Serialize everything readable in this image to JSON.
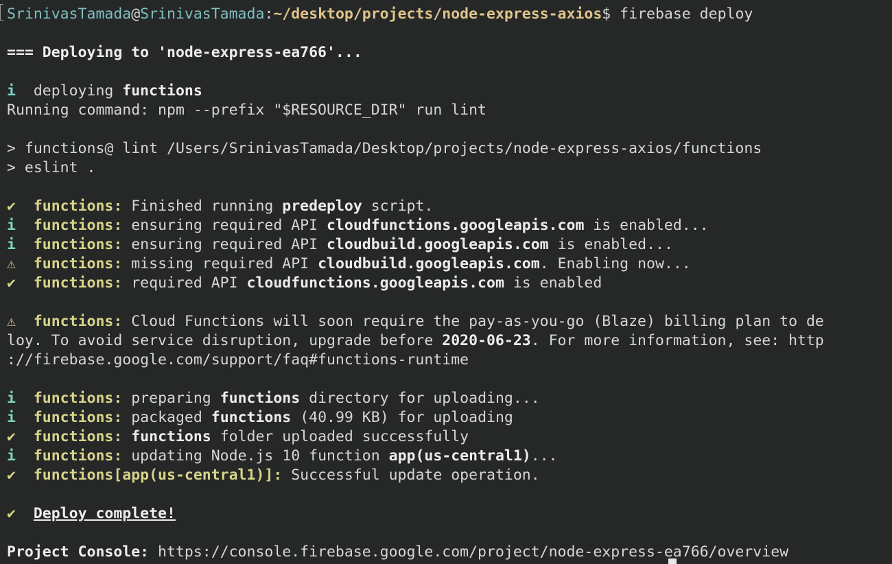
{
  "prompt": {
    "user": "SrinivasTamada",
    "at": "@",
    "host": "SrinivasTamada",
    "colon": ":",
    "path": "~/desktop/projects/node-express-axios",
    "dollar": "$",
    "command": " firebase deploy"
  },
  "deploy_header": "=== Deploying to 'node-express-ea766'...",
  "info_deploying": {
    "icon": "i",
    "text": "  deploying ",
    "bold": "functions"
  },
  "running_command": "Running command: npm --prefix \"$RESOURCE_DIR\" run lint",
  "lint_line1": "> functions@ lint /Users/SrinivasTamada/Desktop/projects/node-express-axios/functions",
  "lint_line2": "> eslint .",
  "fn_label": "functions:",
  "log": {
    "l1": {
      "icon": "✔",
      "a": " Finished running ",
      "b": "predeploy",
      "c": " script."
    },
    "l2": {
      "icon": "i",
      "a": " ensuring required API ",
      "b": "cloudfunctions.googleapis.com",
      "c": " is enabled..."
    },
    "l3": {
      "icon": "i",
      "a": " ensuring required API ",
      "b": "cloudbuild.googleapis.com",
      "c": " is enabled..."
    },
    "l4": {
      "icon": "⚠",
      "a": " missing required API ",
      "b": "cloudbuild.googleapis.com",
      "c": ". Enabling now..."
    },
    "l5": {
      "icon": "✔",
      "a": " required API ",
      "b": "cloudfunctions.googleapis.com",
      "c": " is enabled"
    }
  },
  "warning": {
    "icon": "⚠",
    "line1": " Cloud Functions will soon require the pay-as-you-go (Blaze) billing plan to de",
    "line2a": "loy. To avoid service disruption, upgrade before ",
    "line2b": "2020-06-23",
    "line2c": ". For more information, see: http",
    "line3": "://firebase.google.com/support/faq#functions-runtime"
  },
  "upload": {
    "u1": {
      "icon": "i",
      "a": " preparing ",
      "b": "functions",
      "c": " directory for uploading..."
    },
    "u2": {
      "icon": "i",
      "a": " packaged ",
      "b": "functions",
      "c": " (40.99 KB) for uploading"
    },
    "u3": {
      "icon": "✔",
      "a": " ",
      "b": "functions",
      "c": " folder uploaded successfully"
    },
    "u4": {
      "icon": "i",
      "a": " updating Node.js 10 function ",
      "b": "app(us-central1)",
      "c": "..."
    },
    "u5": {
      "icon": "✔",
      "label": "functions[app(us-central1)]:",
      "c": " Successful update operation."
    }
  },
  "complete": {
    "icon": "✔",
    "text": "Deploy complete!"
  },
  "console": {
    "label": "Project Console:",
    "url": " https://console.firebase.google.com/project/node-express-ea766/overview"
  }
}
